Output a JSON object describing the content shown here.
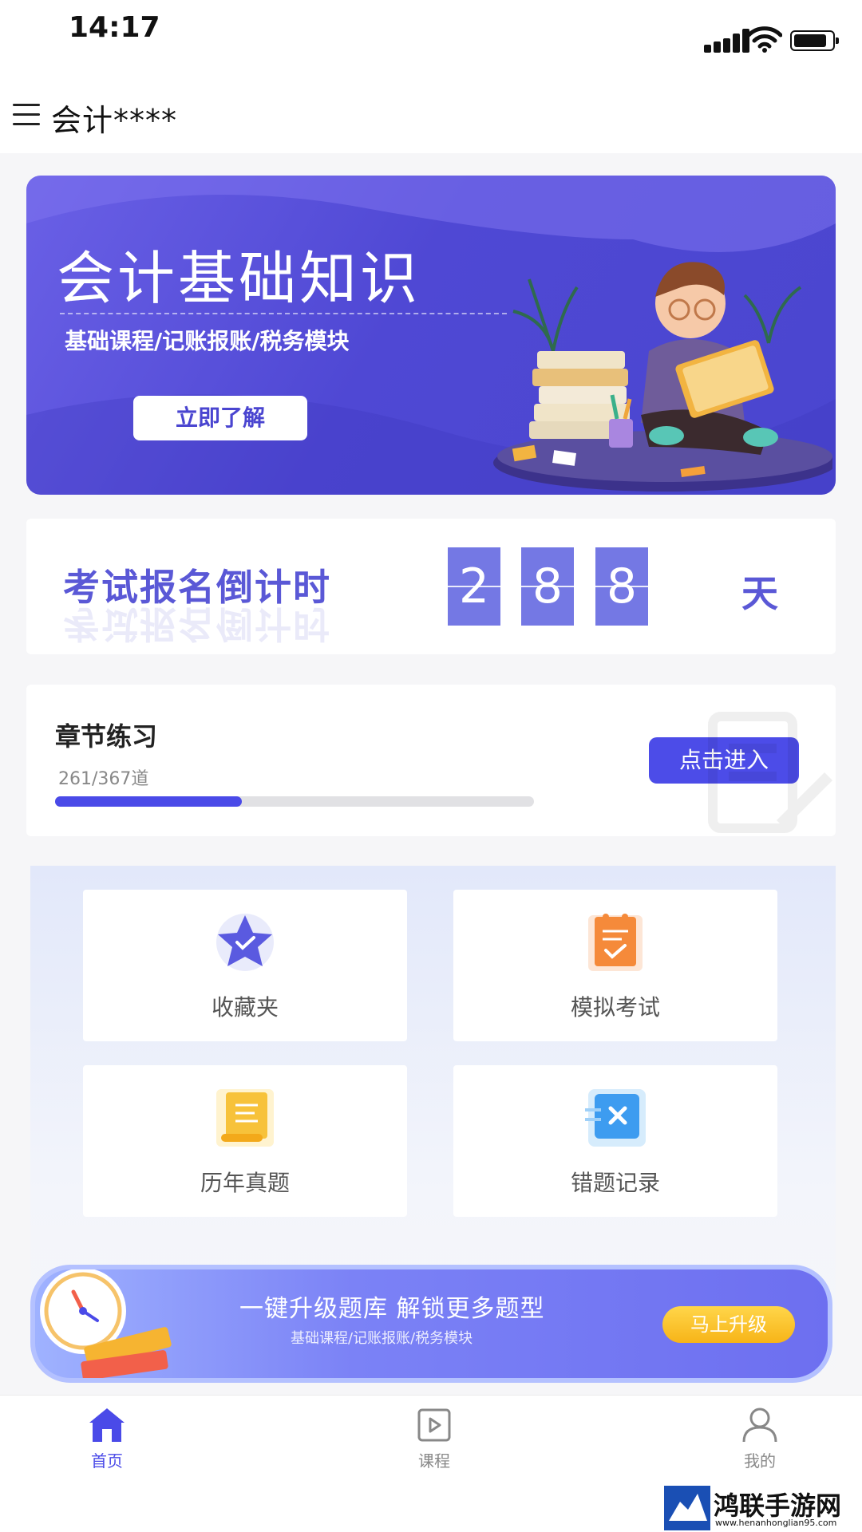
{
  "status_bar": {
    "time": "14:17"
  },
  "header": {
    "title": "会计****"
  },
  "banner": {
    "title": "会计基础知识",
    "subtitle": "基础课程/记账报账/税务模块",
    "button_label": "立即了解"
  },
  "countdown": {
    "label": "考试报名倒计时",
    "digits": [
      "2",
      "8",
      "8"
    ],
    "unit": "天"
  },
  "chapter": {
    "title": "章节练习",
    "progress_text": "261/367道",
    "progress_fraction": 0.39,
    "button_label": "点击进入"
  },
  "grid": [
    {
      "label": "收藏夹",
      "icon": "star-icon"
    },
    {
      "label": "模拟考试",
      "icon": "clipboard-check-icon"
    },
    {
      "label": "历年真题",
      "icon": "scroll-icon"
    },
    {
      "label": "错题记录",
      "icon": "error-x-icon"
    }
  ],
  "promo": {
    "title": "一键升级题库 解锁更多题型",
    "subtitle": "基础课程/记账报账/税务模块",
    "button_label": "马上升级"
  },
  "tabs": [
    {
      "label": "首页",
      "icon": "home-icon",
      "active": true
    },
    {
      "label": "课程",
      "icon": "video-icon",
      "active": false
    },
    {
      "label": "我的",
      "icon": "user-icon",
      "active": false
    }
  ],
  "watermark": {
    "text": "鸿联手游网",
    "url": "www.henanhonglian95.com"
  },
  "colors": {
    "accent": "#4a4ae8",
    "banner": "#5a53dc",
    "promo_button": "#f7b418"
  }
}
